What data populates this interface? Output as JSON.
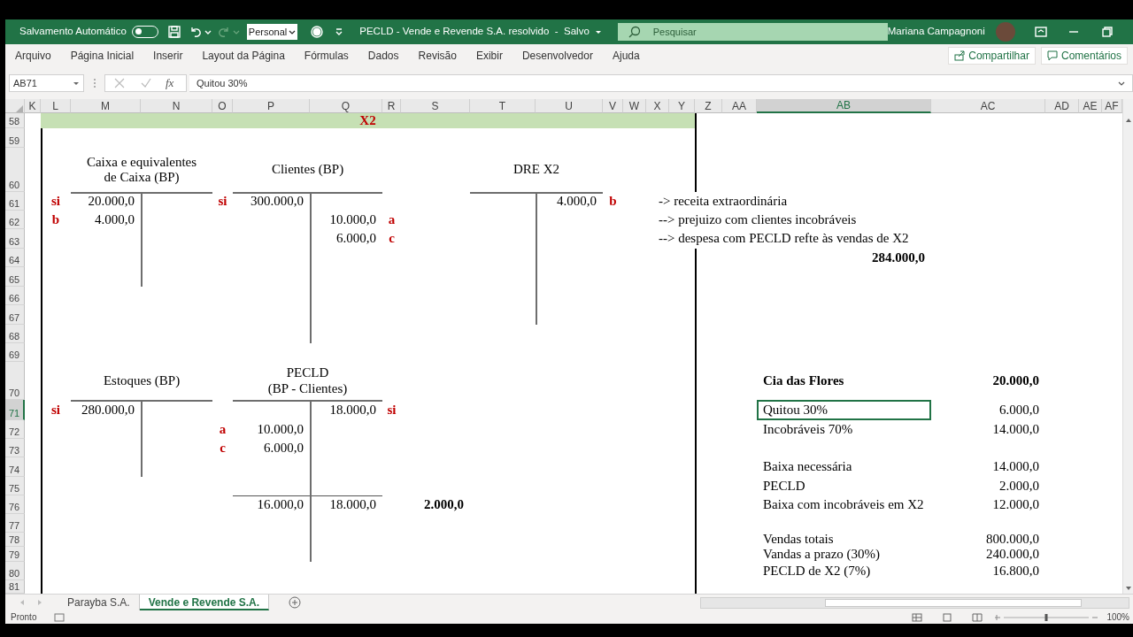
{
  "title_bar": {
    "autosave": {
      "label": "Salvamento Automático",
      "on": false
    },
    "style_box": "Personal",
    "document_title": "PECLD - Vende e Revende S.A. resolvido  -  Salvo",
    "search": {
      "placeholder": "Pesquisar"
    },
    "user": "Mariana Campagnoni"
  },
  "ribbon_tabs": [
    {
      "label": "Arquivo",
      "selected": false
    },
    {
      "label": "Página Inicial",
      "selected": false
    },
    {
      "label": "Inserir",
      "selected": false
    },
    {
      "label": "Layout da Página",
      "selected": false
    },
    {
      "label": "Fórmulas",
      "selected": false
    },
    {
      "label": "Dados",
      "selected": false
    },
    {
      "label": "Revisão",
      "selected": false
    },
    {
      "label": "Exibir",
      "selected": false
    },
    {
      "label": "Desenvolvedor",
      "selected": false
    },
    {
      "label": "Ajuda",
      "selected": false
    }
  ],
  "ribbon_buttons": [
    "Compartilhar",
    "Comentários"
  ],
  "formula_bar": {
    "name_box": "AB71",
    "fx": "fx",
    "formula": "Quitou 30%"
  },
  "columns": [
    {
      "label": "K",
      "selected": false
    },
    {
      "label": "L",
      "selected": false
    },
    {
      "label": "M",
      "selected": false
    },
    {
      "label": "N",
      "selected": false
    },
    {
      "label": "O",
      "selected": false
    },
    {
      "label": "P",
      "selected": false
    },
    {
      "label": "Q",
      "selected": false
    },
    {
      "label": "R",
      "selected": false
    },
    {
      "label": "S",
      "selected": false
    },
    {
      "label": "T",
      "selected": false
    },
    {
      "label": "U",
      "selected": false
    },
    {
      "label": "V",
      "selected": false
    },
    {
      "label": "W",
      "selected": false
    },
    {
      "label": "X",
      "selected": false
    },
    {
      "label": "Y",
      "selected": false
    },
    {
      "label": "Z",
      "selected": false
    },
    {
      "label": "AA",
      "selected": false
    },
    {
      "label": "AB",
      "selected": true
    },
    {
      "label": "AC",
      "selected": false
    },
    {
      "label": "AD",
      "selected": false
    },
    {
      "label": "AE",
      "selected": false
    },
    {
      "label": "AF",
      "selected": false
    }
  ],
  "rows": [
    {
      "number": "58",
      "selected": false,
      "cells": [
        {
          "kind": "band",
          "text": "X2",
          "selected": false
        }
      ]
    },
    {
      "number": "59",
      "selected": false
    },
    {
      "number": "60",
      "selected": false,
      "cells": [
        {
          "kind": "title",
          "text": "Caixa e equivalentes de Caixa (BP)",
          "selected": false
        },
        {
          "kind": "title",
          "text": "Clientes (BP)",
          "selected": false
        },
        {
          "kind": "title",
          "text": "DRE X2",
          "selected": false
        }
      ]
    },
    {
      "number": "61",
      "selected": false,
      "cells": [
        {
          "kind": "mark",
          "text": "si",
          "selected": false
        },
        {
          "kind": "value",
          "text": "20.000,0",
          "selected": false
        },
        {
          "kind": "mark",
          "text": "si",
          "selected": false
        },
        {
          "kind": "value",
          "text": "300.000,0",
          "selected": false
        },
        {
          "kind": "value",
          "text": "4.000,0",
          "selected": false
        },
        {
          "kind": "mark",
          "text": "b",
          "selected": false
        },
        {
          "kind": "note",
          "text": "-> receita extraordinária",
          "selected": false
        }
      ]
    },
    {
      "number": "62",
      "selected": false,
      "cells": [
        {
          "kind": "mark",
          "text": "b",
          "selected": false
        },
        {
          "kind": "value",
          "text": "4.000,0",
          "selected": false
        },
        {
          "kind": "value",
          "text": "10.000,0",
          "selected": false
        },
        {
          "kind": "mark",
          "text": "a",
          "selected": false
        },
        {
          "kind": "note",
          "text": "--> prejuizo com clientes incobráveis",
          "selected": false
        }
      ]
    },
    {
      "number": "63",
      "selected": false,
      "cells": [
        {
          "kind": "value",
          "text": "6.000,0",
          "selected": false
        },
        {
          "kind": "mark",
          "text": "c",
          "selected": false
        },
        {
          "kind": "note",
          "text": "--> despesa com PECLD refte às vendas de X2",
          "selected": false
        }
      ]
    },
    {
      "number": "64",
      "selected": false,
      "cells": [
        {
          "kind": "total",
          "text": "284.000,0",
          "selected": false
        }
      ]
    },
    {
      "number": "65",
      "selected": false
    },
    {
      "number": "66",
      "selected": false
    },
    {
      "number": "67",
      "selected": false
    },
    {
      "number": "68",
      "selected": false
    },
    {
      "number": "69",
      "selected": false
    },
    {
      "number": "70",
      "selected": false,
      "cells": [
        {
          "kind": "title",
          "text": "Estoques (BP)",
          "selected": false
        },
        {
          "kind": "title",
          "text": "PECLD\n(BP - Clientes)",
          "selected": false
        },
        {
          "kind": "label-bold",
          "text": "Cia das Flores",
          "selected": false
        },
        {
          "kind": "total",
          "text": "20.000,0",
          "selected": false
        }
      ]
    },
    {
      "number": "71",
      "selected": true,
      "cells": [
        {
          "kind": "mark",
          "text": "si",
          "selected": false
        },
        {
          "kind": "value",
          "text": "280.000,0",
          "selected": false
        },
        {
          "kind": "value",
          "text": "18.000,0",
          "selected": false
        },
        {
          "kind": "mark",
          "text": "si",
          "selected": false
        },
        {
          "kind": "label",
          "text": "Quitou 30%",
          "selected": true
        },
        {
          "kind": "value",
          "text": "6.000,0",
          "selected": false
        }
      ]
    },
    {
      "number": "72",
      "selected": false,
      "cells": [
        {
          "kind": "mark",
          "text": "a",
          "selected": false
        },
        {
          "kind": "value",
          "text": "10.000,0",
          "selected": false
        },
        {
          "kind": "label",
          "text": "Incobráveis 70%",
          "selected": false
        },
        {
          "kind": "value",
          "text": "14.000,0",
          "selected": false
        }
      ]
    },
    {
      "number": "73",
      "selected": false,
      "cells": [
        {
          "kind": "mark",
          "text": "c",
          "selected": false
        },
        {
          "kind": "value",
          "text": "6.000,0",
          "selected": false
        }
      ]
    },
    {
      "number": "74",
      "selected": false,
      "cells": [
        {
          "kind": "label",
          "text": "Baixa necessária",
          "selected": false
        },
        {
          "kind": "value",
          "text": "14.000,0",
          "selected": false
        }
      ]
    },
    {
      "number": "75",
      "selected": false,
      "cells": [
        {
          "kind": "label",
          "text": "PECLD",
          "selected": false
        },
        {
          "kind": "value",
          "text": "2.000,0",
          "selected": false
        }
      ]
    },
    {
      "number": "76",
      "selected": false,
      "cells": [
        {
          "kind": "value",
          "text": "16.000,0",
          "selected": false
        },
        {
          "kind": "value",
          "text": "18.000,0",
          "selected": false
        },
        {
          "kind": "total",
          "text": "2.000,0",
          "selected": false
        },
        {
          "kind": "label",
          "text": "Baixa com incobráveis em X2",
          "selected": false
        },
        {
          "kind": "value",
          "text": "12.000,0",
          "selected": false
        }
      ]
    },
    {
      "number": "77",
      "selected": false
    },
    {
      "number": "78",
      "selected": false,
      "cells": [
        {
          "kind": "label",
          "text": "Vendas totais",
          "selected": false
        },
        {
          "kind": "value",
          "text": "800.000,0",
          "selected": false
        }
      ]
    },
    {
      "number": "79",
      "selected": false,
      "cells": [
        {
          "kind": "label",
          "text": "Vandas a prazo (30%)",
          "selected": false
        },
        {
          "kind": "value",
          "text": "240.000,0",
          "selected": false
        }
      ]
    },
    {
      "number": "80",
      "selected": false,
      "cells": [
        {
          "kind": "label",
          "text": "PECLD de X2 (7%)",
          "selected": false
        },
        {
          "kind": "value",
          "text": "16.800,0",
          "selected": false
        }
      ]
    },
    {
      "number": "81",
      "selected": false
    }
  ],
  "sheet_tabs": [
    {
      "label": "Parayba S.A.",
      "selected": false
    },
    {
      "label": "Vende e Revende S.A.",
      "selected": true
    }
  ],
  "status_bar": {
    "status": "Pronto",
    "zoom_slider": {
      "level": 0.5
    },
    "zoom": "100%"
  }
}
